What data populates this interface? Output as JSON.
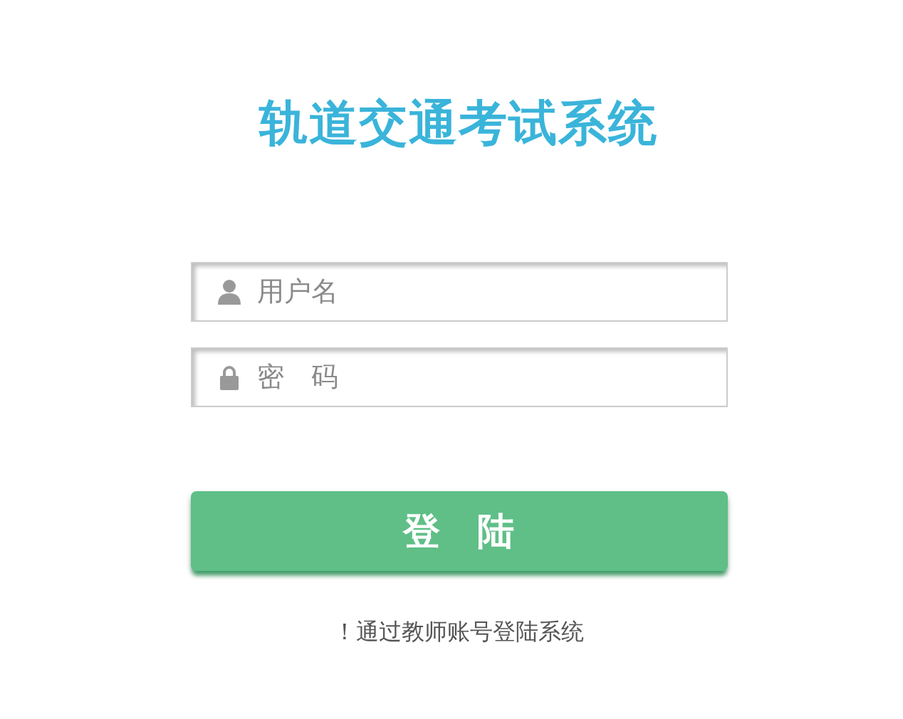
{
  "title": "轨道交通考试系统",
  "fields": [
    {
      "kind": "user",
      "placeholder": "用户名"
    },
    {
      "kind": "password",
      "placeholder": "密　码"
    }
  ],
  "login_button": "登　陆",
  "note": "！通过教师账号登陆系统"
}
